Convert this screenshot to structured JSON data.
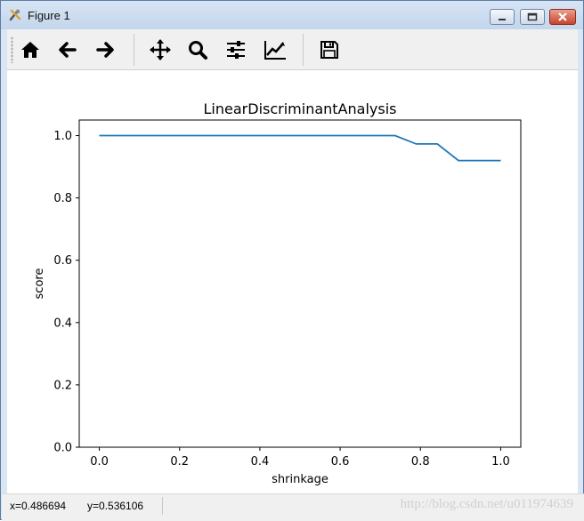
{
  "window": {
    "title": "Figure 1"
  },
  "toolbar": {
    "icons": [
      "home-icon",
      "back-arrow-icon",
      "forward-arrow-icon",
      "pan-move-icon",
      "zoom-magnifier-icon",
      "subplots-sliders-icon",
      "edit-axes-icon",
      "save-floppy-icon"
    ]
  },
  "chart_data": {
    "type": "line",
    "title": "LinearDiscriminantAnalysis",
    "xlabel": "shrinkage",
    "ylabel": "score",
    "xlim": [
      -0.05,
      1.05
    ],
    "ylim": [
      0.0,
      1.05
    ],
    "xticks": [
      "0.0",
      "0.2",
      "0.4",
      "0.6",
      "0.8",
      "1.0"
    ],
    "yticks": [
      "0.0",
      "0.2",
      "0.4",
      "0.6",
      "0.8",
      "1.0"
    ],
    "x": [
      0.0,
      0.7368,
      0.7895,
      0.8421,
      0.8947,
      0.9474,
      1.0
    ],
    "y": [
      1.0,
      1.0,
      0.9733,
      0.9733,
      0.92,
      0.92,
      0.92
    ],
    "grid": false,
    "color": "#1f77b4"
  },
  "status": {
    "x": "x=0.486694",
    "y": "y=0.536106",
    "watermark": "http://blog.csdn.net/u011974639"
  }
}
